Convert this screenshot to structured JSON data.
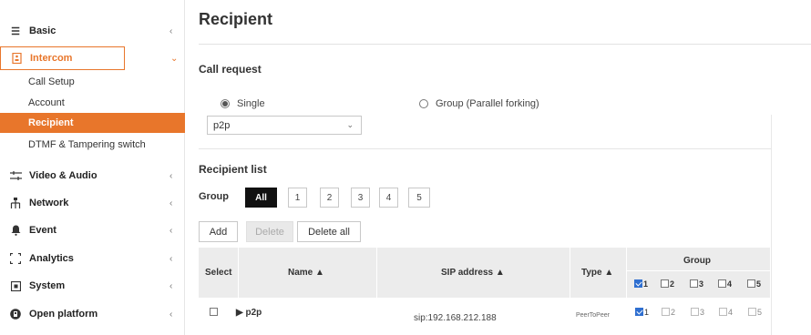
{
  "sidebar": {
    "items": [
      {
        "label": "Basic",
        "icon": "list-icon"
      },
      {
        "label": "Intercom",
        "icon": "intercom-icon"
      },
      {
        "label": "Video & Audio",
        "icon": "video-audio-icon"
      },
      {
        "label": "Network",
        "icon": "network-icon"
      },
      {
        "label": "Event",
        "icon": "bell-icon"
      },
      {
        "label": "Analytics",
        "icon": "analytics-icon"
      },
      {
        "label": "System",
        "icon": "system-icon"
      },
      {
        "label": "Open platform",
        "icon": "open-platform-icon"
      }
    ],
    "intercom_sub": [
      "Call Setup",
      "Account",
      "Recipient",
      "DTMF & Tampering switch"
    ],
    "active_sub": "Recipient",
    "accent_color": "#e8762b"
  },
  "main": {
    "title": "Recipient",
    "call_request": {
      "title": "Call request",
      "options": [
        "Single",
        "Group (Parallel forking)"
      ],
      "selected": "Single",
      "select_value": "p2p"
    },
    "recipient_list": {
      "title": "Recipient list",
      "group_label": "Group",
      "group_buttons": [
        "All",
        "1",
        "2",
        "3",
        "4",
        "5"
      ],
      "active_group": "All",
      "actions": {
        "add": "Add",
        "delete": "Delete",
        "delete_all": "Delete all"
      },
      "table": {
        "headers": {
          "select": "Select",
          "name": "Name ▲",
          "sip": "SIP address ▲",
          "type": "Type ▲",
          "group": "Group"
        },
        "group_cols": [
          "1",
          "2",
          "3",
          "4",
          "5"
        ],
        "header_group_checked": [
          true,
          false,
          false,
          false,
          false
        ],
        "rows": [
          {
            "name": "▶ p2p",
            "sip": "sip:192.168.212.188",
            "type": "PeerToPeer",
            "groups": [
              true,
              false,
              false,
              false,
              false
            ]
          }
        ]
      }
    }
  }
}
